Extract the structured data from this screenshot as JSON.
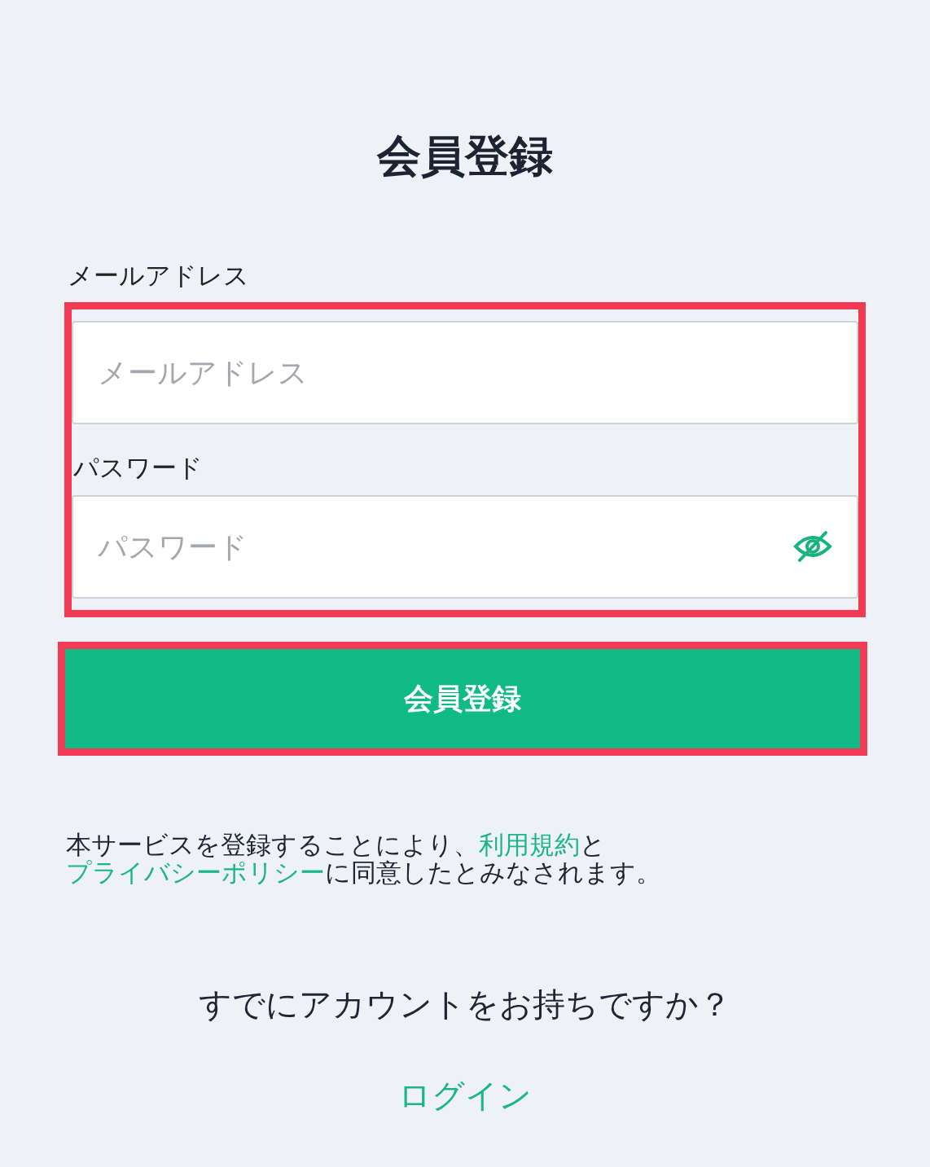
{
  "title": "会員登録",
  "form": {
    "highlighted": true,
    "fields": [
      {
        "label": "メールアドレス",
        "placeholder": "メールアドレス"
      },
      {
        "label": "パスワード",
        "placeholder": "パスワード",
        "toggle_visibility": true
      }
    ]
  },
  "submit_button": {
    "label": "会員登録",
    "highlighted": true
  },
  "terms": [
    {
      "text": "本サービスを登録することにより、",
      "link": false
    },
    {
      "text": "利用規約",
      "link": true
    },
    {
      "text": "と",
      "link": false
    },
    {
      "text": "プライバシーポリシー",
      "link": true
    },
    {
      "text": "に同意したとみなされます。",
      "link": false
    }
  ],
  "login_prompt": "すでにアカウントをお持ちですか？",
  "login_link": "ログイン"
}
